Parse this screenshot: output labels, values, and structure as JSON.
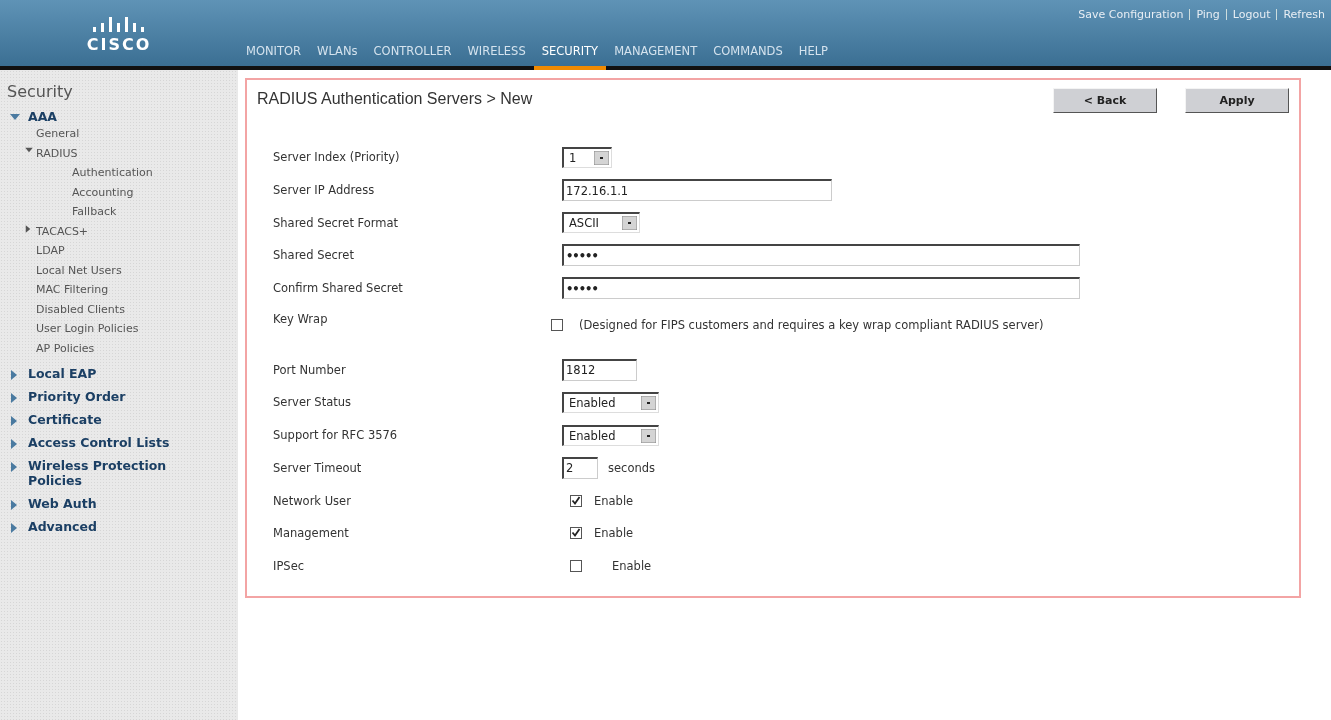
{
  "header": {
    "logo": "CISCO",
    "top_links": [
      "Save Configuration",
      "Ping",
      "Logout",
      "Refresh"
    ],
    "nav": [
      {
        "label": "MONITOR",
        "selected": false
      },
      {
        "label": "WLANs",
        "selected": false
      },
      {
        "label": "CONTROLLER",
        "selected": false
      },
      {
        "label": "WIRELESS",
        "selected": false
      },
      {
        "label": "SECURITY",
        "selected": true
      },
      {
        "label": "MANAGEMENT",
        "selected": false
      },
      {
        "label": "COMMANDS",
        "selected": false
      },
      {
        "label": "HELP",
        "selected": false
      }
    ]
  },
  "sidebar": {
    "title": "Security",
    "items": [
      {
        "label": "AAA",
        "expanded": true,
        "children": [
          {
            "label": "General"
          },
          {
            "label": "RADIUS",
            "expanded": true,
            "children": [
              {
                "label": "Authentication"
              },
              {
                "label": "Accounting"
              },
              {
                "label": "Fallback"
              }
            ]
          },
          {
            "label": "TACACS+",
            "expanded": false
          },
          {
            "label": "LDAP"
          },
          {
            "label": "Local Net Users"
          },
          {
            "label": "MAC Filtering"
          },
          {
            "label": "Disabled Clients"
          },
          {
            "label": "User Login Policies"
          },
          {
            "label": "AP Policies"
          }
        ]
      },
      {
        "label": "Local EAP",
        "expanded": false
      },
      {
        "label": "Priority Order",
        "expanded": false
      },
      {
        "label": "Certificate",
        "expanded": false
      },
      {
        "label": "Access Control Lists",
        "expanded": false
      },
      {
        "label": "Wireless Protection Policies",
        "expanded": false
      },
      {
        "label": "Web Auth",
        "expanded": false
      },
      {
        "label": "Advanced",
        "expanded": false
      }
    ]
  },
  "main": {
    "title": "RADIUS Authentication Servers > New",
    "buttons": [
      "< Back",
      "Apply"
    ],
    "fields": [
      {
        "kind": "select",
        "label": "Server Index (Priority)",
        "value": "1"
      },
      {
        "kind": "text",
        "label": "Server IP Address",
        "value": "172.16.1.1"
      },
      {
        "kind": "select",
        "label": "Shared Secret Format",
        "value": "ASCII"
      },
      {
        "kind": "secret",
        "label": "Shared Secret",
        "value": "•••••"
      },
      {
        "kind": "secret",
        "label": "Confirm Shared Secret",
        "value": "•••••"
      },
      {
        "kind": "checkbox",
        "label": "Key Wrap",
        "checked": false,
        "note": "(Designed for FIPS customers and requires a key wrap compliant RADIUS server)"
      },
      {
        "kind": "text",
        "label": "Port Number",
        "value": "1812"
      },
      {
        "kind": "select",
        "label": "Server Status",
        "value": "Enabled"
      },
      {
        "kind": "select",
        "label": "Support for RFC 3576",
        "value": "Enabled"
      },
      {
        "kind": "text",
        "label": "Server Timeout",
        "value": "2",
        "suffix": "seconds"
      },
      {
        "kind": "checkbox",
        "label": "Network User",
        "checked": true,
        "note": "Enable"
      },
      {
        "kind": "checkbox",
        "label": "Management",
        "checked": true,
        "note": "Enable"
      },
      {
        "kind": "checkbox",
        "label": "IPSec",
        "checked": false,
        "note": "Enable"
      }
    ]
  }
}
